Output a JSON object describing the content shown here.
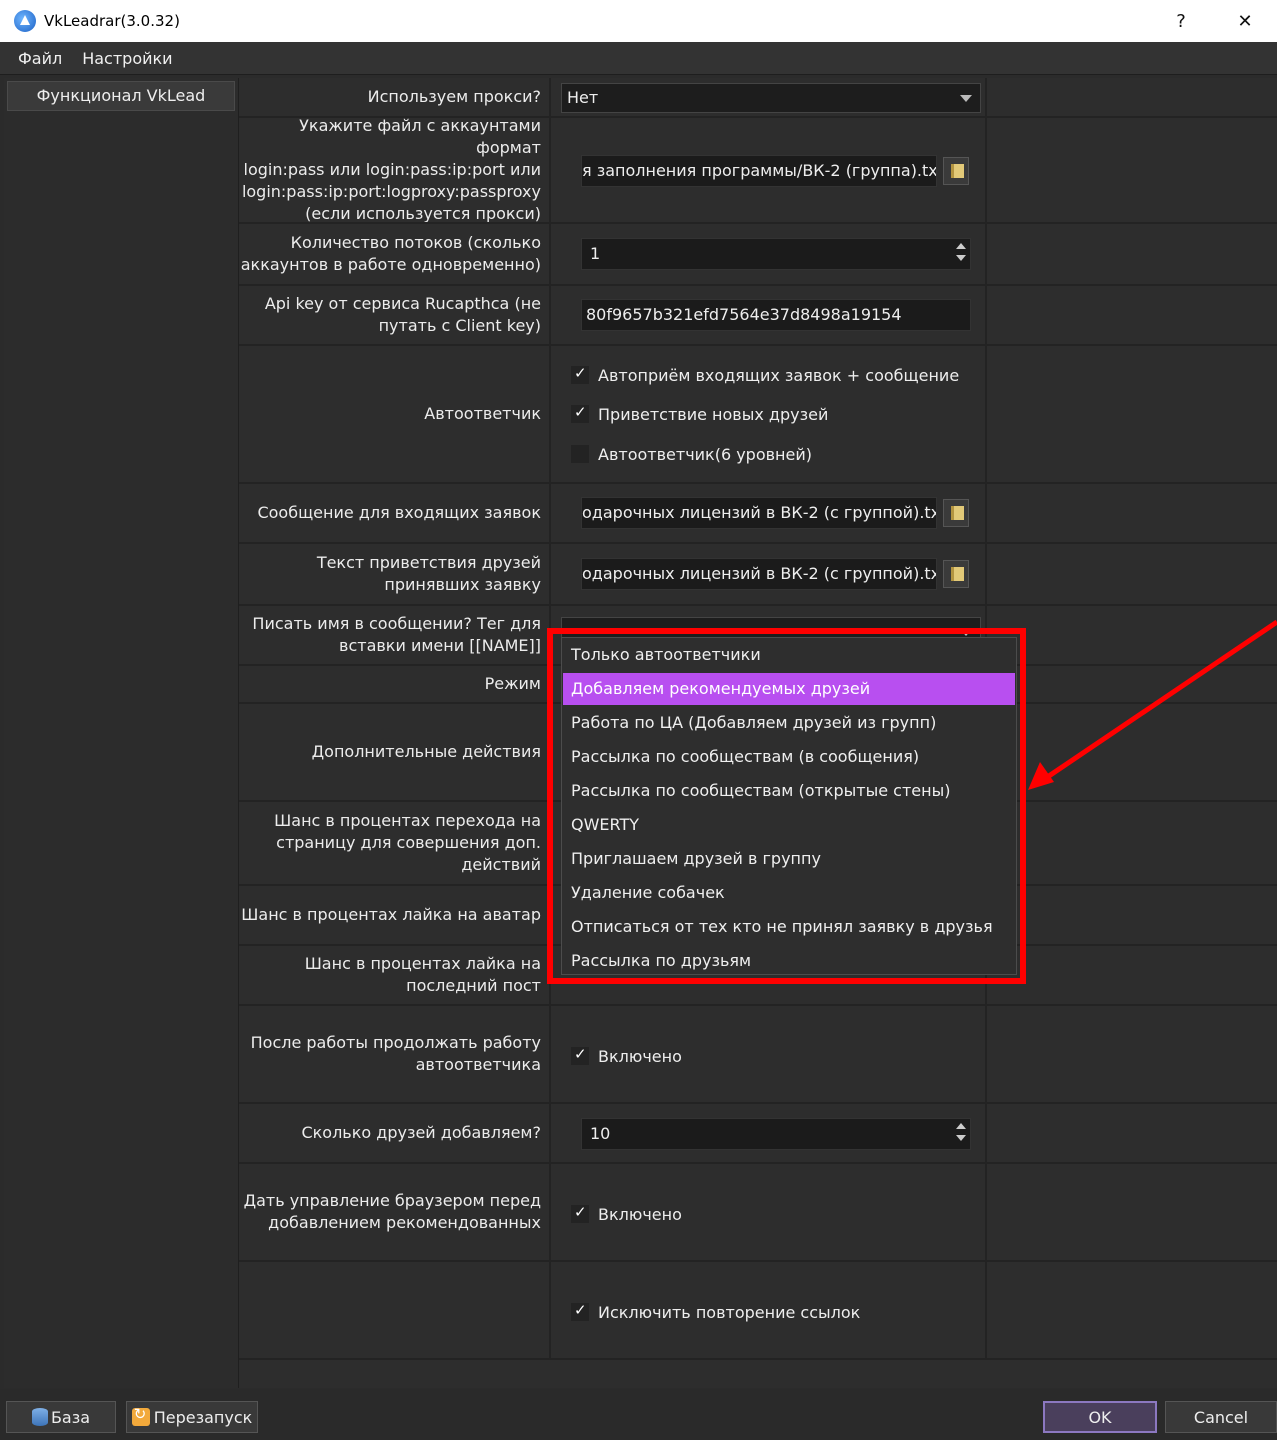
{
  "window": {
    "title": "VkLeadrar(3.0.32)",
    "help": "?",
    "close": "✕"
  },
  "menu": {
    "file": "Файл",
    "settings": "Настройки"
  },
  "left_tab": "Функционал VkLead",
  "rows": {
    "proxy": {
      "label": "Используем прокси?",
      "value": "Нет"
    },
    "accounts": {
      "label": "Укажите файл с аккаунтами формат\nlogin:pass или login:pass:ip:port или\nlogin:pass:ip:port:logproxy:passproxy\n(если используется прокси)",
      "value": "я заполнения программы/ВК-2 (группа).txt"
    },
    "threads": {
      "label": "Количество потоков (сколько\nаккаунтов в работе одновременно)",
      "value": "1"
    },
    "apikey": {
      "label": "Api key от сервиса Rucapthca (не\nпутать с Client key)",
      "value": "80f9657b321efd7564e37d8498a19154"
    },
    "autoresponder": {
      "label": "Автоответчик",
      "opt1": "Автоприём входящих заявок + сообщение",
      "opt2": "Приветствие новых друзей",
      "opt3": "Автоответчик(6 уровней)"
    },
    "incoming_msg": {
      "label": "Сообщение для входящих заявок",
      "value": "одарочных лицензий в ВК-2 (с группой).txt"
    },
    "greeting_text": {
      "label": "Текст приветствия друзей\nпринявших заявку",
      "value": "одарочных лицензий в ВК-2 (с группой).txt"
    },
    "write_name": {
      "label": "Писать имя в сообщении? Тег для\nвставки имени [[NAME]]"
    },
    "mode": {
      "label": "Режим"
    },
    "extra_actions": {
      "label": "Дополнительные действия"
    },
    "chance_page": {
      "label": "Шанс в процентах перехода на\nстраницу для совершения доп.\nдействий"
    },
    "chance_avatar": {
      "label": "Шанс в процентах лайка на аватар"
    },
    "chance_post": {
      "label": "Шанс в процентах лайка на\nпоследний пост"
    },
    "continue_after": {
      "label": "После работы продолжать работу\nавтоответчика",
      "check": "Включено"
    },
    "friends_count": {
      "label": "Сколько друзей добавляем?",
      "value": "10"
    },
    "browser_control": {
      "label": "Дать управление браузером перед\nдобавлением рекомендованных",
      "check": "Включено"
    },
    "exclude_repeat": {
      "check": "Исключить повторение ссылок"
    }
  },
  "dropdown": {
    "items": [
      "Только автоответчики",
      "Добавляем рекомендуемых друзей",
      "Работа по ЦА (Добавляем друзей из групп)",
      "Рассылка по сообществам (в сообщения)",
      "Рассылка по сообществам (открытые стены)",
      "QWERTY",
      "Приглашаем друзей в группу",
      "Удаление собачек",
      "Отписаться от тех кто не принял заявку в друзья",
      "Рассылка по друзьям"
    ],
    "selected_index": 1,
    "selected_color": "#b84ff0"
  },
  "bottom": {
    "db": "База",
    "restart": "Перезапуск",
    "ok": "OK",
    "cancel": "Cancel"
  },
  "colors": {
    "highlight": "#ff0000"
  }
}
